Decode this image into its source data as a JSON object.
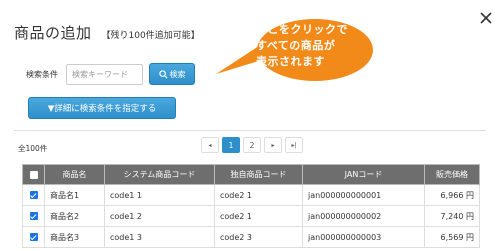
{
  "dialog": {
    "title": "商品の追加",
    "remaining": "【残り100件追加可能】"
  },
  "search": {
    "label": "検索条件",
    "placeholder": "検索キーワード",
    "button_label": "検索",
    "advanced_label": "▼詳細に検索条件を指定する"
  },
  "callout": {
    "line1": "ここをクリックで",
    "line2": "すべての商品が",
    "line3": "表示されます",
    "color": "#f28a1a"
  },
  "results": {
    "count": "全100件"
  },
  "pagination": {
    "first": "◂",
    "pages": [
      "1",
      "2"
    ],
    "active_page": "1",
    "next": "▸",
    "last": "▸|"
  },
  "table": {
    "headers": [
      "商品名",
      "システム商品コード",
      "独自商品コード",
      "JANコード",
      "販売価格"
    ],
    "rows": [
      [
        "商品名1",
        "code1 1",
        "code2 1",
        "jan000000000001",
        "6,966 円"
      ],
      [
        "商品名2",
        "code1 2",
        "code2 1",
        "jan000000000002",
        "7,240 円"
      ],
      [
        "商品名3",
        "code1 3",
        "code2 3",
        "jan000000000003",
        "6,569 円"
      ]
    ]
  },
  "colors": {
    "accent": "#2f8fca",
    "header_bg": "#6e6e6e",
    "callout": "#f28a1a"
  }
}
